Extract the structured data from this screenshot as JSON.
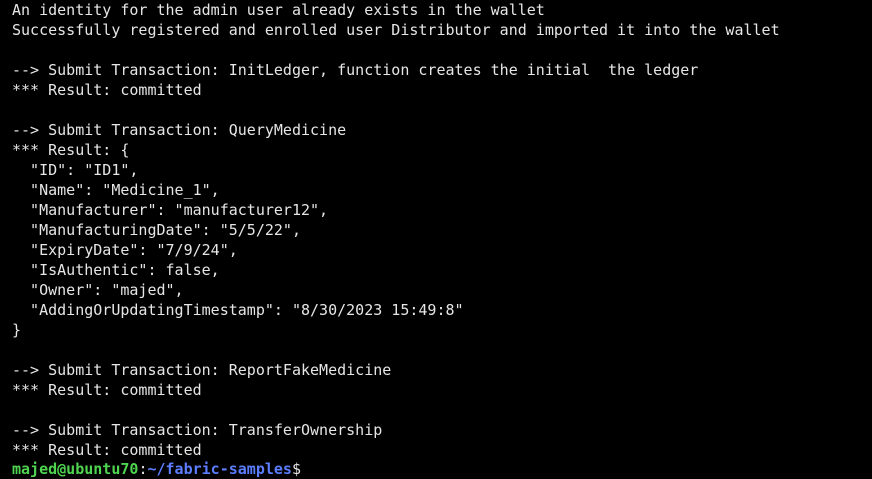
{
  "terminal": {
    "lines": [
      "An identity for the admin user already exists in the wallet",
      "Successfully registered and enrolled user Distributor and imported it into the wallet",
      "",
      "--> Submit Transaction: InitLedger, function creates the initial  the ledger",
      "*** Result: committed",
      "",
      "--> Submit Transaction: QueryMedicine",
      "*** Result: {",
      "  \"ID\": \"ID1\",",
      "  \"Name\": \"Medicine_1\",",
      "  \"Manufacturer\": \"manufacturer12\",",
      "  \"ManufacturingDate\": \"5/5/22\",",
      "  \"ExpiryDate\": \"7/9/24\",",
      "  \"IsAuthentic\": false,",
      "  \"Owner\": \"majed\",",
      "  \"AddingOrUpdatingTimestamp\": \"8/30/2023 15:49:8\"",
      "}",
      "",
      "--> Submit Transaction: ReportFakeMedicine",
      "*** Result: committed",
      "",
      "--> Submit Transaction: TransferOwnership",
      "*** Result: committed"
    ],
    "prompt": {
      "user_host": "majed@ubuntu70",
      "separator": ":",
      "path": "~/fabric-samples",
      "symbol": "$"
    }
  },
  "colors": {
    "background": "#000000",
    "text": "#e6e6e6",
    "prompt_user": "#4fd44f",
    "prompt_path": "#5c7dff"
  }
}
